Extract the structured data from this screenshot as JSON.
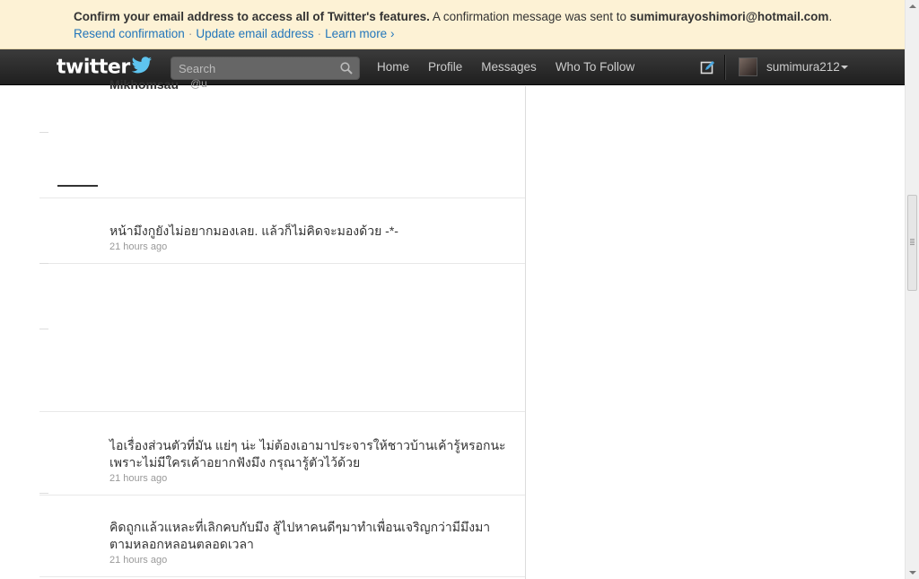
{
  "banner": {
    "bold_text": "Confirm your email address to access all of Twitter's features.",
    "text": " A confirmation message was sent to ",
    "email": "sumimurayoshimori@hotmail.com",
    "period": ".",
    "links": [
      "Resend confirmation",
      "Update email address",
      "Learn more ›"
    ],
    "separator": "·"
  },
  "topbar": {
    "logo": "twitter",
    "search_placeholder": "Search",
    "nav": [
      "Home",
      "Profile",
      "Messages",
      "Who To Follow"
    ],
    "username": "sumimura212",
    "icons": {
      "search": "magnifier-icon",
      "compose": "compose-tweet-icon",
      "caret": "caret-down-icon"
    }
  },
  "timeline": {
    "partial_header": {
      "name": "Mikhomsau",
      "handle": "@u"
    },
    "tweets": [
      {
        "text": "หน้ามึงกูยังไม่อยากมองเลย. แล้วก็ไม่คิดจะมองด้วย -*-",
        "time": "21 hours ago"
      },
      {
        "text": "ไอเรื่องส่วนตัวที่มัน แย่ๆ น่ะ ไม่ต้องเอามาประจารให้ชาวบ้านเค้ารู้หรอกนะ เพราะไม่มีใครเค้าอยากฟังมึง กรุณารู้ตัวไว้ด้วย",
        "time": "21 hours ago"
      },
      {
        "text": "คิดถูกแล้วแหละที่เลิกคบกับมึง สู้ไปหาคนดีๆมาทำเพื่อนเจริญกว่ามีมึงมาตามหลอกหลอนตลอดเวลา",
        "time": "21 hours ago"
      }
    ]
  },
  "colors": {
    "banner_bg": "#fdf2d5",
    "link": "#2276bb",
    "topbar": "#2b2b2b"
  }
}
